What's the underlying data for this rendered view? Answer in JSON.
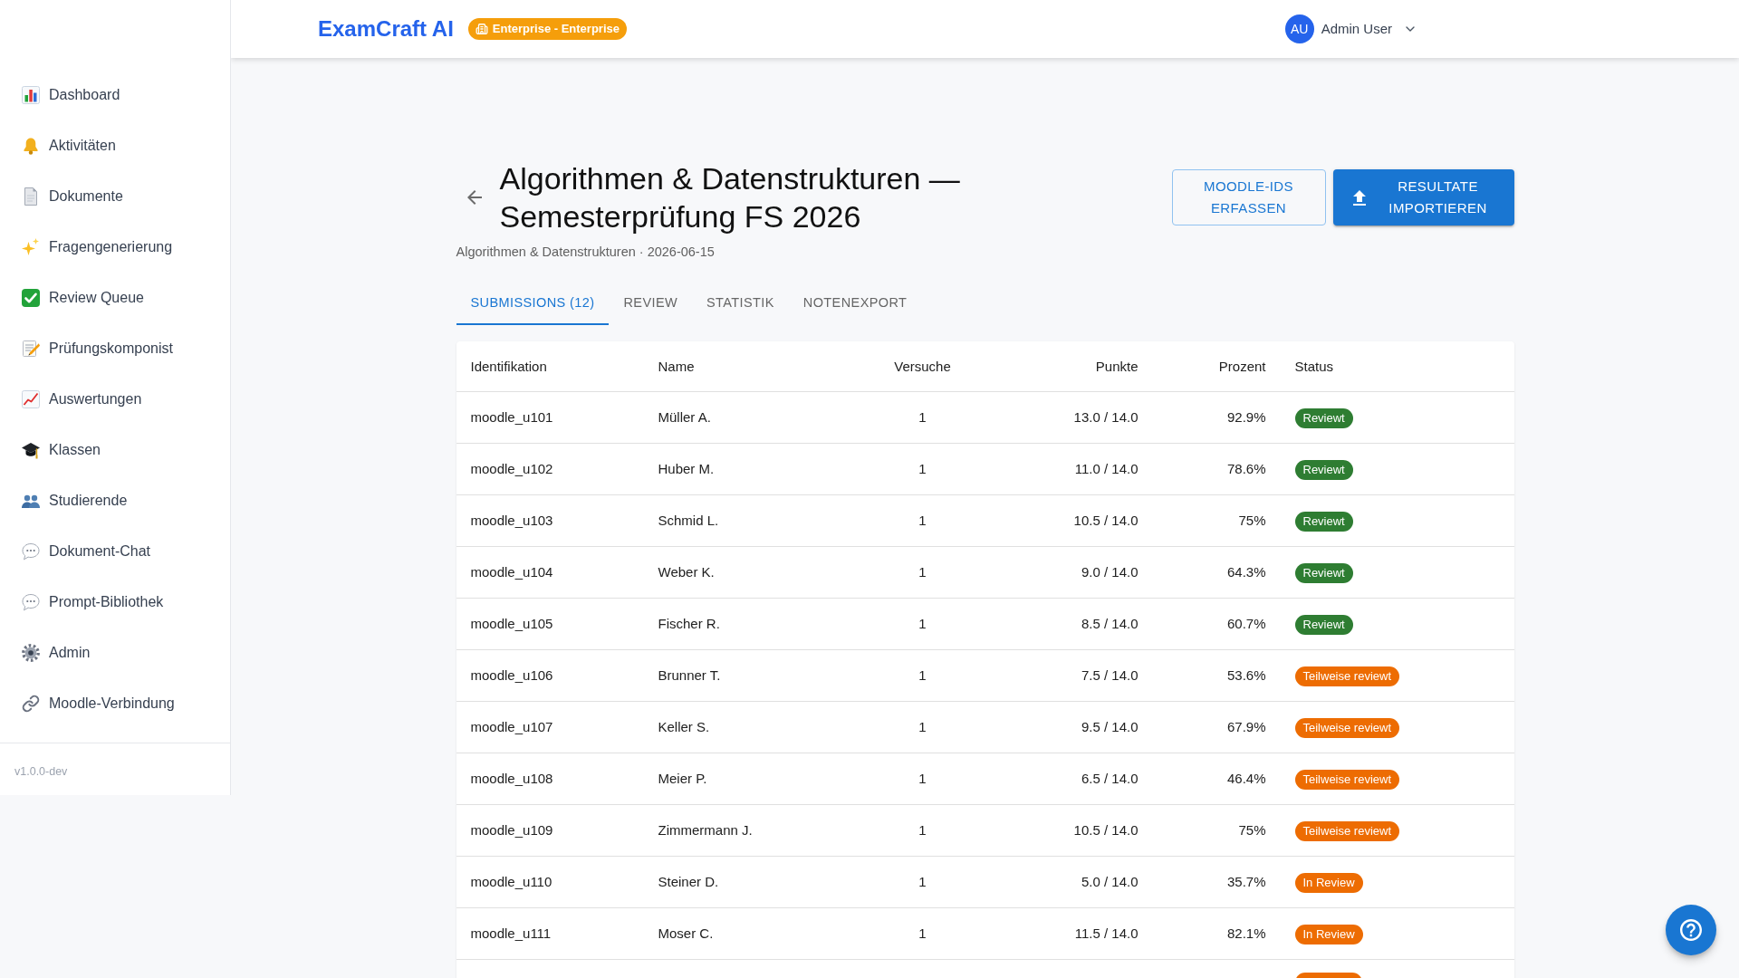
{
  "header": {
    "logo": "ExamCraft AI",
    "plan_badge": "Enterprise - Enterprise",
    "user": {
      "initials": "AU",
      "name": "Admin User"
    }
  },
  "sidebar": {
    "items": [
      {
        "label": "Dashboard"
      },
      {
        "label": "Aktivitäten"
      },
      {
        "label": "Dokumente"
      },
      {
        "label": "Fragengenerierung"
      },
      {
        "label": "Review Queue"
      },
      {
        "label": "Prüfungskomponist"
      },
      {
        "label": "Auswertungen"
      },
      {
        "label": "Klassen"
      },
      {
        "label": "Studierende"
      },
      {
        "label": "Dokument-Chat"
      },
      {
        "label": "Prompt-Bibliothek"
      },
      {
        "label": "Admin"
      },
      {
        "label": "Moodle-Verbindung"
      }
    ],
    "version": "v1.0.0-dev"
  },
  "page": {
    "title": "Algorithmen & Datenstrukturen — Semesterprüfung FS 2026",
    "subtitle": "Algorithmen & Datenstrukturen · 2026-06-15",
    "actions": [
      {
        "label": "MOODLE-IDS ERFASSEN",
        "kind": "outlined"
      },
      {
        "label": "RESULTATE IMPORTIEREN",
        "kind": "contained"
      }
    ]
  },
  "tabs": [
    {
      "label": "SUBMISSIONS (12)",
      "selected": true
    },
    {
      "label": "REVIEW",
      "selected": false
    },
    {
      "label": "STATISTIK",
      "selected": false
    },
    {
      "label": "NOTENEXPORT",
      "selected": false
    }
  ],
  "table": {
    "columns": [
      "Identifikation",
      "Name",
      "Versuche",
      "Punkte",
      "Prozent",
      "Status"
    ],
    "rows": [
      {
        "id": "moodle_u101",
        "name": "Müller A.",
        "attempts": "1",
        "points": "13.0 / 14.0",
        "percent": "92.9%",
        "status": {
          "label": "Reviewt",
          "color": "#2e7d32"
        }
      },
      {
        "id": "moodle_u102",
        "name": "Huber M.",
        "attempts": "1",
        "points": "11.0 / 14.0",
        "percent": "78.6%",
        "status": {
          "label": "Reviewt",
          "color": "#2e7d32"
        }
      },
      {
        "id": "moodle_u103",
        "name": "Schmid L.",
        "attempts": "1",
        "points": "10.5 / 14.0",
        "percent": "75%",
        "status": {
          "label": "Reviewt",
          "color": "#2e7d32"
        }
      },
      {
        "id": "moodle_u104",
        "name": "Weber K.",
        "attempts": "1",
        "points": "9.0 / 14.0",
        "percent": "64.3%",
        "status": {
          "label": "Reviewt",
          "color": "#2e7d32"
        }
      },
      {
        "id": "moodle_u105",
        "name": "Fischer R.",
        "attempts": "1",
        "points": "8.5 / 14.0",
        "percent": "60.7%",
        "status": {
          "label": "Reviewt",
          "color": "#2e7d32"
        }
      },
      {
        "id": "moodle_u106",
        "name": "Brunner T.",
        "attempts": "1",
        "points": "7.5 / 14.0",
        "percent": "53.6%",
        "status": {
          "label": "Teilweise reviewt",
          "color": "#ed6c02"
        }
      },
      {
        "id": "moodle_u107",
        "name": "Keller S.",
        "attempts": "1",
        "points": "9.5 / 14.0",
        "percent": "67.9%",
        "status": {
          "label": "Teilweise reviewt",
          "color": "#ed6c02"
        }
      },
      {
        "id": "moodle_u108",
        "name": "Meier P.",
        "attempts": "1",
        "points": "6.5 / 14.0",
        "percent": "46.4%",
        "status": {
          "label": "Teilweise reviewt",
          "color": "#ed6c02"
        }
      },
      {
        "id": "moodle_u109",
        "name": "Zimmermann J.",
        "attempts": "1",
        "points": "10.5 / 14.0",
        "percent": "75%",
        "status": {
          "label": "Teilweise reviewt",
          "color": "#ed6c02"
        }
      },
      {
        "id": "moodle_u110",
        "name": "Steiner D.",
        "attempts": "1",
        "points": "5.0 / 14.0",
        "percent": "35.7%",
        "status": {
          "label": "In Review",
          "color": "#ed6c02"
        }
      },
      {
        "id": "moodle_u111",
        "name": "Moser C.",
        "attempts": "1",
        "points": "11.5 / 14.0",
        "percent": "82.1%",
        "status": {
          "label": "In Review",
          "color": "#ed6c02"
        }
      },
      {
        "status": {
          "color": "#ed6c02"
        }
      }
    ]
  }
}
